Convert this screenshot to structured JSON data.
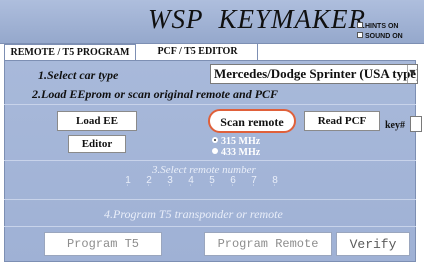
{
  "app": {
    "title": "WSP  KEYMAKER",
    "options": [
      {
        "label": "HINTS ON",
        "checked": true
      },
      {
        "label": "SOUND ON",
        "checked": true
      }
    ]
  },
  "tabs": [
    {
      "label": "REMOTE / T5 PROGRAM",
      "active": true
    },
    {
      "label": "PCF / T5  EDITOR",
      "active": false
    }
  ],
  "step1": {
    "label": "1.Select car type",
    "selected": "Mercedes/Dodge Sprinter (USA type)"
  },
  "step2": {
    "label": "2.Load EEprom or scan original remote and PCF"
  },
  "buttons": {
    "load_ee": "Load EE",
    "editor": "Editor",
    "scan_remote": "Scan remote",
    "read_pcf": "Read PCF",
    "key_label": "key#",
    "key_value": ""
  },
  "frequency": {
    "options": [
      "315 MHz",
      "433 MHz"
    ],
    "selected": "315 MHz"
  },
  "step3": {
    "label": "3.Select remote number",
    "numbers": [
      "1",
      "2",
      "3",
      "4",
      "5",
      "6",
      "7",
      "8"
    ]
  },
  "step4": {
    "label": "4.Program T5 transponder or remote"
  },
  "actions": {
    "program_t5": "Program T5",
    "program_remote": "Program Remote",
    "verify": "Verify"
  },
  "colors": {
    "accent_scan_outline": "#e0603a",
    "panel": "#a8b9da"
  }
}
